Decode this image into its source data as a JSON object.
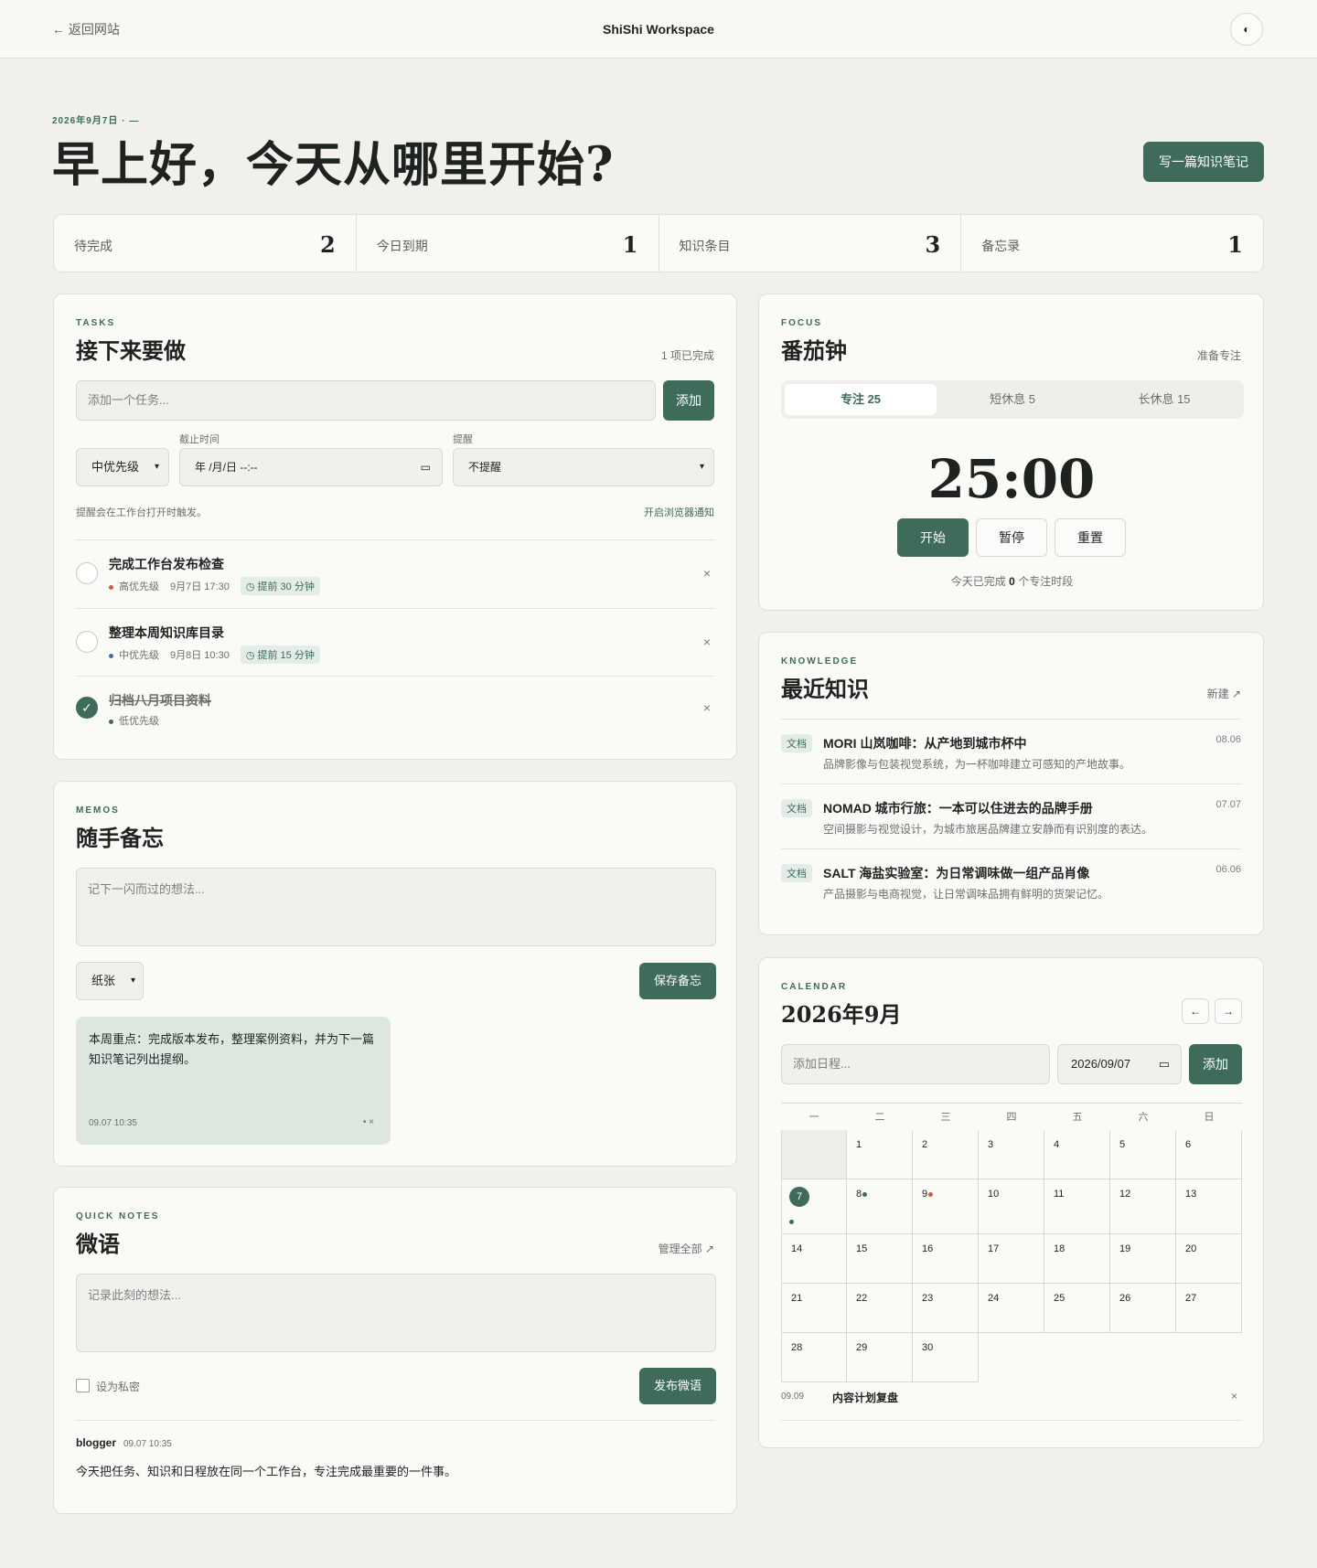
{
  "topbar": {
    "back": "← 返回网站",
    "brand": "ShiShi Workspace",
    "theme_icon": "◐"
  },
  "hero": {
    "date": "2026年9月7日 · —",
    "greeting": "早上好，今天从哪里开始?",
    "write_button": "写一篇知识笔记"
  },
  "stats": [
    {
      "label": "待完成",
      "value": "2"
    },
    {
      "label": "今日到期",
      "value": "1"
    },
    {
      "label": "知识条目",
      "value": "3"
    },
    {
      "label": "备忘录",
      "value": "1"
    }
  ],
  "tasks": {
    "eyebrow": "TASKS",
    "title": "接下来要做",
    "meta": "1 项已完成",
    "input_placeholder": "添加一个任务...",
    "add": "添加",
    "priority": "中优先级",
    "deadline_label": "截止时间",
    "deadline_value": "年 /月/日 --:--",
    "reminder_label": "提醒",
    "reminder_value": "不提醒",
    "hint": "提醒会在工作台打开时触发。",
    "notify": "开启浏览器通知",
    "items": [
      {
        "title": "完成工作台发布检查",
        "priority": "高优先级",
        "due": "9月7日 17:30",
        "remind": "◷ 提前 30 分钟",
        "done": false,
        "color": "#c2653f"
      },
      {
        "title": "整理本周知识库目录",
        "priority": "中优先级",
        "due": "9月8日 10:30",
        "remind": "◷ 提前 15 分钟",
        "done": false,
        "color": "#4b6c9a"
      },
      {
        "title": "归档八月项目资料",
        "priority": "低优先级",
        "due": "",
        "remind": "",
        "done": true,
        "color": "#3f6b5a"
      }
    ],
    "close": "×",
    "check": "✓"
  },
  "memos": {
    "eyebrow": "MEMOS",
    "title": "随手备忘",
    "placeholder": "记下一闪而过的想法...",
    "style": "纸张",
    "save": "保存备忘",
    "note": {
      "text": "本周重点：完成版本发布，整理案例资料，并为下一篇知识笔记列出提纲。",
      "time": "09.07 10:35",
      "actions": "• ×"
    }
  },
  "quick": {
    "eyebrow": "QUICK NOTES",
    "title": "微语",
    "manage": "管理全部 ↗",
    "placeholder": "记录此刻的想法...",
    "private": "设为私密",
    "publish": "发布微语",
    "post": {
      "author": "blogger",
      "time": "09.07 10:35",
      "text": "今天把任务、知识和日程放在同一个工作台，专注完成最重要的一件事。"
    }
  },
  "focus": {
    "eyebrow": "FOCUS",
    "title": "番茄钟",
    "meta": "准备专注",
    "tabs": [
      "专注 25",
      "短休息 5",
      "长休息 15"
    ],
    "timer": "25:00",
    "start": "开始",
    "pause": "暂停",
    "reset": "重置",
    "done_prefix": "今天已完成",
    "done_count": "0",
    "done_suffix": "个专注时段"
  },
  "knowledge": {
    "eyebrow": "KNOWLEDGE",
    "title": "最近知识",
    "new": "新建 ↗",
    "items": [
      {
        "badge": "文档",
        "title": "MORI 山岚咖啡：从产地到城市杯中",
        "desc": "品牌影像与包装视觉系统，为一杯咖啡建立可感知的产地故事。",
        "date": "08.06"
      },
      {
        "badge": "文档",
        "title": "NOMAD 城市行旅：一本可以住进去的品牌手册",
        "desc": "空间摄影与视觉设计，为城市旅居品牌建立安静而有识别度的表达。",
        "date": "07.07"
      },
      {
        "badge": "文档",
        "title": "SALT 海盐实验室：为日常调味做一组产品肖像",
        "desc": "产品摄影与电商视觉，让日常调味品拥有鲜明的货架记忆。",
        "date": "06.06"
      }
    ]
  },
  "calendar": {
    "eyebrow": "CALENDAR",
    "title": "2026年9月",
    "prev": "←",
    "next": "→",
    "placeholder": "添加日程...",
    "date_value": "2026/09/07",
    "add": "添加",
    "weekdays": [
      "一",
      "二",
      "三",
      "四",
      "五",
      "六",
      "日"
    ],
    "event": {
      "date": "09.09",
      "title": "内容计划复盘",
      "close": "×"
    }
  }
}
